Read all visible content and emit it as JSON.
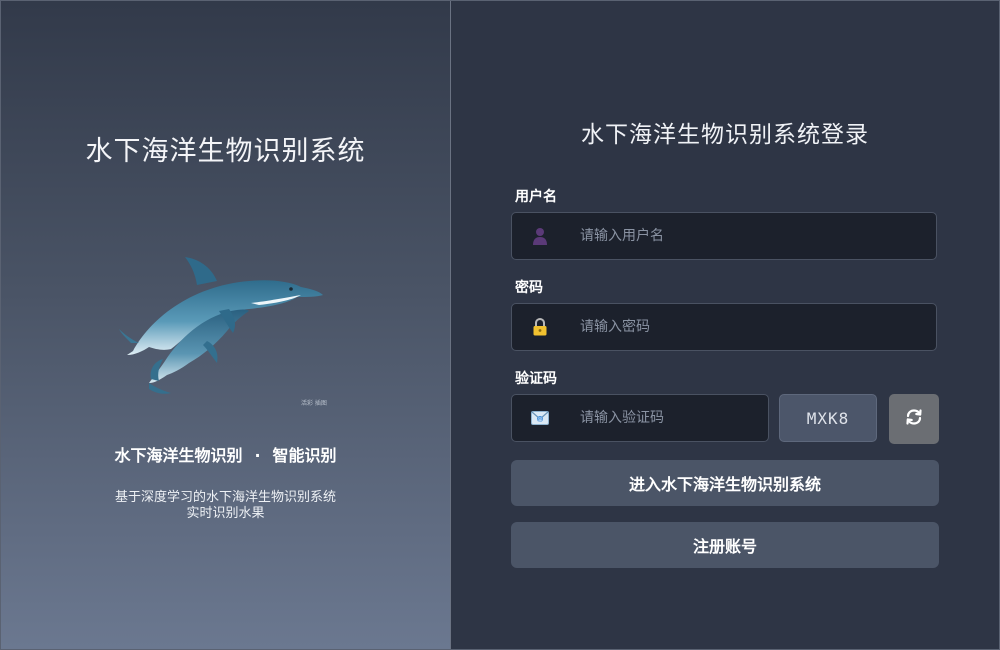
{
  "left": {
    "brand_title": "水下海洋生物识别系统",
    "watermark": "活彩 插图",
    "tagline_left": "水下海洋生物识别",
    "tagline_sep": "·",
    "tagline_right": "智能识别",
    "desc_line1": "基于深度学习的水下海洋生物识别系统",
    "desc_line2": "实时识别水果",
    "illustration": "dolphins-illustration"
  },
  "login": {
    "title": "水下海洋生物识别系统登录",
    "username": {
      "label": "用户名",
      "placeholder": "请输入用户名",
      "value": "",
      "icon": "user-icon"
    },
    "password": {
      "label": "密码",
      "placeholder": "请输入密码",
      "value": "",
      "icon": "lock-icon"
    },
    "captcha": {
      "label": "验证码",
      "placeholder": "请输入验证码",
      "value": "",
      "icon": "envelope-icon",
      "code": "MXK8",
      "refresh_icon": "refresh-icon"
    },
    "submit_label": "进入水下海洋生物识别系统",
    "register_label": "注册账号"
  },
  "colors": {
    "panel_bg": "#2e3545",
    "input_bg": "#1c212c",
    "button_bg": "#4b5567",
    "refresh_bg": "#6b6e73"
  }
}
